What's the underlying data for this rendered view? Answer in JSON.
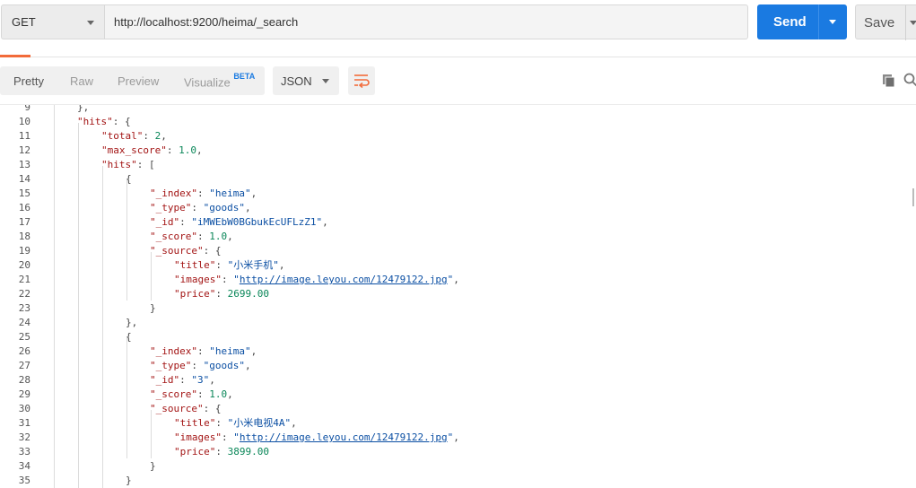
{
  "request": {
    "method": "GET",
    "url": "http://localhost:9200/heima/_search",
    "send_label": "Send",
    "save_label": "Save"
  },
  "response_toolbar": {
    "view_tabs": [
      "Pretty",
      "Raw",
      "Preview",
      "Visualize"
    ],
    "beta_badge": "BETA",
    "active_tab": "Pretty",
    "format": "JSON"
  },
  "colors": {
    "send": "#1a7ae1",
    "accent": "#f26b3a",
    "key": "#a31515",
    "string": "#0b4fa3",
    "number": "#098658"
  },
  "icons": [
    "chevron-down-icon",
    "wrap-lines-icon",
    "copy-icon",
    "search-icon"
  ],
  "code": {
    "lines": [
      {
        "n": "9",
        "indent": 1,
        "parts": [
          [
            "p",
            "},"
          ]
        ]
      },
      {
        "n": "10",
        "indent": 1,
        "parts": [
          [
            "k",
            "\"hits\""
          ],
          [
            "p",
            ": {"
          ]
        ]
      },
      {
        "n": "11",
        "indent": 2,
        "parts": [
          [
            "k",
            "\"total\""
          ],
          [
            "p",
            ": "
          ],
          [
            "n",
            "2"
          ],
          [
            "p",
            ","
          ]
        ]
      },
      {
        "n": "12",
        "indent": 2,
        "parts": [
          [
            "k",
            "\"max_score\""
          ],
          [
            "p",
            ": "
          ],
          [
            "n",
            "1.0"
          ],
          [
            "p",
            ","
          ]
        ]
      },
      {
        "n": "13",
        "indent": 2,
        "parts": [
          [
            "k",
            "\"hits\""
          ],
          [
            "p",
            ": ["
          ]
        ]
      },
      {
        "n": "14",
        "indent": 3,
        "parts": [
          [
            "p",
            "{"
          ]
        ]
      },
      {
        "n": "15",
        "indent": 4,
        "parts": [
          [
            "k",
            "\"_index\""
          ],
          [
            "p",
            ": "
          ],
          [
            "s",
            "\"heima\""
          ],
          [
            "p",
            ","
          ]
        ]
      },
      {
        "n": "16",
        "indent": 4,
        "parts": [
          [
            "k",
            "\"_type\""
          ],
          [
            "p",
            ": "
          ],
          [
            "s",
            "\"goods\""
          ],
          [
            "p",
            ","
          ]
        ]
      },
      {
        "n": "17",
        "indent": 4,
        "parts": [
          [
            "k",
            "\"_id\""
          ],
          [
            "p",
            ": "
          ],
          [
            "s",
            "\"iMWEbW0BGbukEcUFLzZ1\""
          ],
          [
            "p",
            ","
          ]
        ]
      },
      {
        "n": "18",
        "indent": 4,
        "parts": [
          [
            "k",
            "\"_score\""
          ],
          [
            "p",
            ": "
          ],
          [
            "n",
            "1.0"
          ],
          [
            "p",
            ","
          ]
        ]
      },
      {
        "n": "19",
        "indent": 4,
        "parts": [
          [
            "k",
            "\"_source\""
          ],
          [
            "p",
            ": {"
          ]
        ]
      },
      {
        "n": "20",
        "indent": 5,
        "parts": [
          [
            "k",
            "\"title\""
          ],
          [
            "p",
            ": "
          ],
          [
            "s",
            "\"小米手机\""
          ],
          [
            "p",
            ","
          ]
        ]
      },
      {
        "n": "21",
        "indent": 5,
        "parts": [
          [
            "k",
            "\"images\""
          ],
          [
            "p",
            ": "
          ],
          [
            "s",
            "\""
          ],
          [
            "u",
            "http://image.leyou.com/12479122.jpg"
          ],
          [
            "s",
            "\""
          ],
          [
            "p",
            ","
          ]
        ]
      },
      {
        "n": "22",
        "indent": 5,
        "parts": [
          [
            "k",
            "\"price\""
          ],
          [
            "p",
            ": "
          ],
          [
            "n",
            "2699.00"
          ]
        ]
      },
      {
        "n": "23",
        "indent": 4,
        "parts": [
          [
            "p",
            "}"
          ]
        ]
      },
      {
        "n": "24",
        "indent": 3,
        "parts": [
          [
            "p",
            "},"
          ]
        ]
      },
      {
        "n": "25",
        "indent": 3,
        "parts": [
          [
            "p",
            "{"
          ]
        ]
      },
      {
        "n": "26",
        "indent": 4,
        "parts": [
          [
            "k",
            "\"_index\""
          ],
          [
            "p",
            ": "
          ],
          [
            "s",
            "\"heima\""
          ],
          [
            "p",
            ","
          ]
        ]
      },
      {
        "n": "27",
        "indent": 4,
        "parts": [
          [
            "k",
            "\"_type\""
          ],
          [
            "p",
            ": "
          ],
          [
            "s",
            "\"goods\""
          ],
          [
            "p",
            ","
          ]
        ]
      },
      {
        "n": "28",
        "indent": 4,
        "parts": [
          [
            "k",
            "\"_id\""
          ],
          [
            "p",
            ": "
          ],
          [
            "s",
            "\"3\""
          ],
          [
            "p",
            ","
          ]
        ]
      },
      {
        "n": "29",
        "indent": 4,
        "parts": [
          [
            "k",
            "\"_score\""
          ],
          [
            "p",
            ": "
          ],
          [
            "n",
            "1.0"
          ],
          [
            "p",
            ","
          ]
        ]
      },
      {
        "n": "30",
        "indent": 4,
        "parts": [
          [
            "k",
            "\"_source\""
          ],
          [
            "p",
            ": {"
          ]
        ]
      },
      {
        "n": "31",
        "indent": 5,
        "parts": [
          [
            "k",
            "\"title\""
          ],
          [
            "p",
            ": "
          ],
          [
            "s",
            "\"小米电视4A\""
          ],
          [
            "p",
            ","
          ]
        ]
      },
      {
        "n": "32",
        "indent": 5,
        "parts": [
          [
            "k",
            "\"images\""
          ],
          [
            "p",
            ": "
          ],
          [
            "s",
            "\""
          ],
          [
            "u",
            "http://image.leyou.com/12479122.jpg"
          ],
          [
            "s",
            "\""
          ],
          [
            "p",
            ","
          ]
        ]
      },
      {
        "n": "33",
        "indent": 5,
        "parts": [
          [
            "k",
            "\"price\""
          ],
          [
            "p",
            ": "
          ],
          [
            "n",
            "3899.00"
          ]
        ]
      },
      {
        "n": "34",
        "indent": 4,
        "parts": [
          [
            "p",
            "}"
          ]
        ]
      },
      {
        "n": "35",
        "indent": 3,
        "parts": [
          [
            "p",
            "}"
          ]
        ]
      }
    ]
  }
}
